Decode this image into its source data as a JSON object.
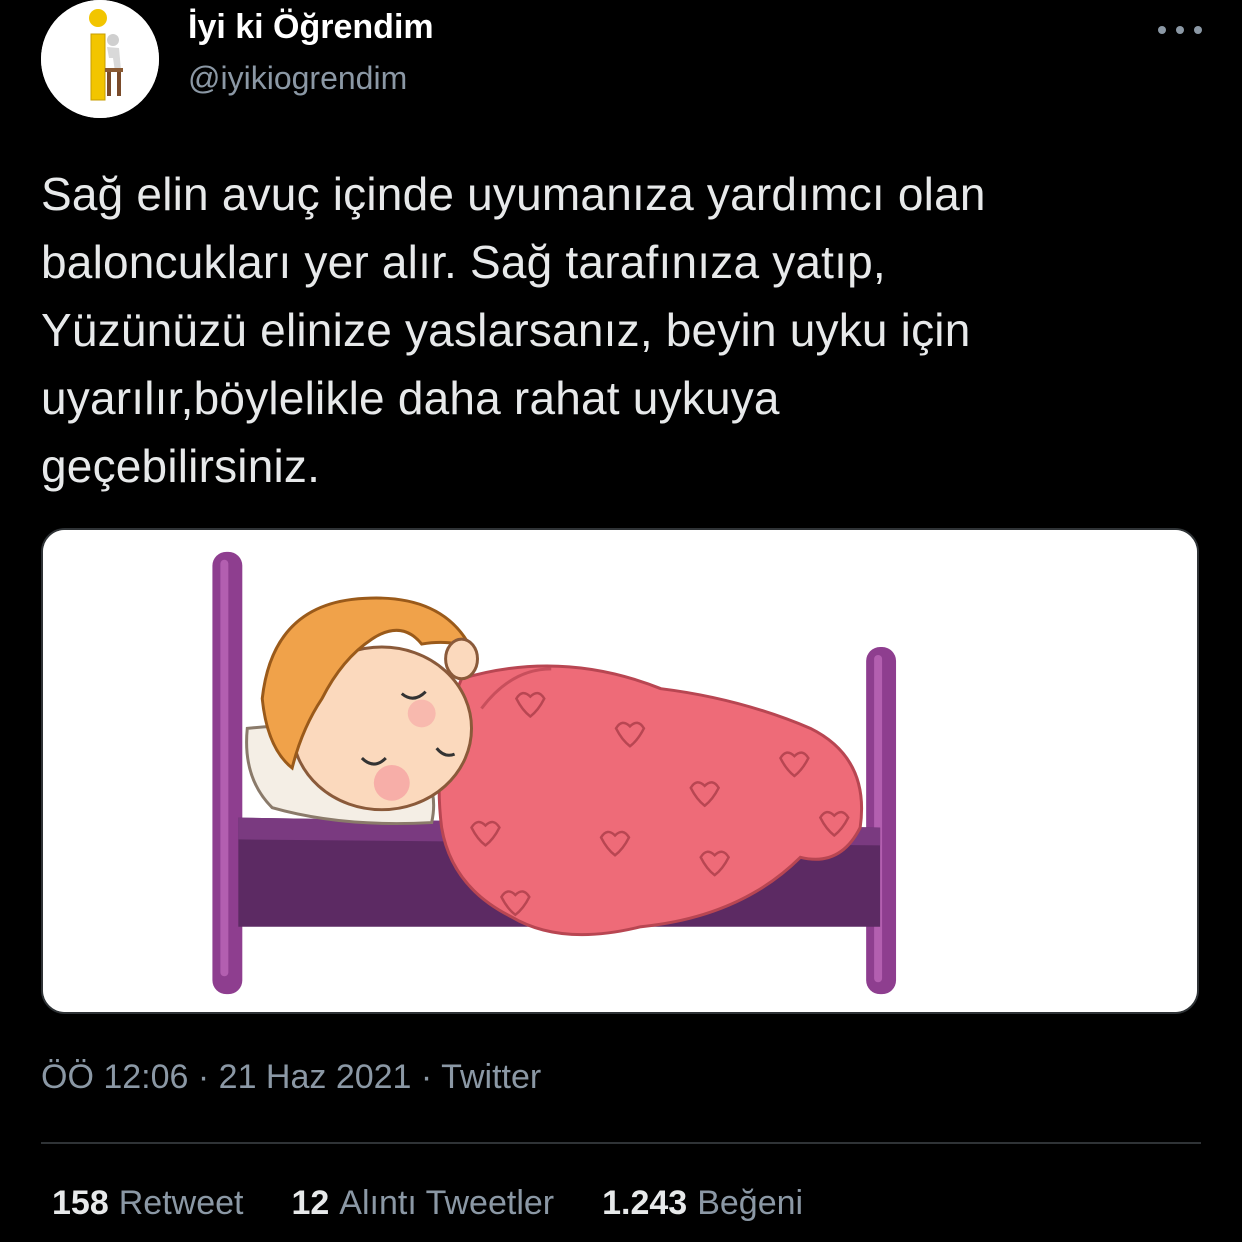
{
  "tweet": {
    "display_name": "İyi ki Öğrendim",
    "handle": "@iyikiogrendim",
    "text": "Sağ elin avuç içinde uyumanıza yardımcı olan\nbaloncukları yer alır. Sağ tarafınıza yatıp,\nYüzünüzü elinize yaslarsanız, beyin uyku için\nuyarılır,böylelikle daha rahat uykuya\ngeçebilirsiniz.",
    "time": "ÖÖ 12:06",
    "date": "21 Haz 2021",
    "source": "Twitter",
    "separator": "·"
  },
  "stats": {
    "retweets_count": "158",
    "retweets_label": "Retweet",
    "quotes_count": "12",
    "quotes_label": "Alıntı Tweetler",
    "likes_count": "1.243",
    "likes_label": "Beğeni"
  },
  "icons": {
    "more": "more-horizontal-icon"
  },
  "colors": {
    "background": "#000000",
    "text": "#e7e9ea",
    "secondary": "#8b98a5",
    "divider": "#2f3336"
  }
}
